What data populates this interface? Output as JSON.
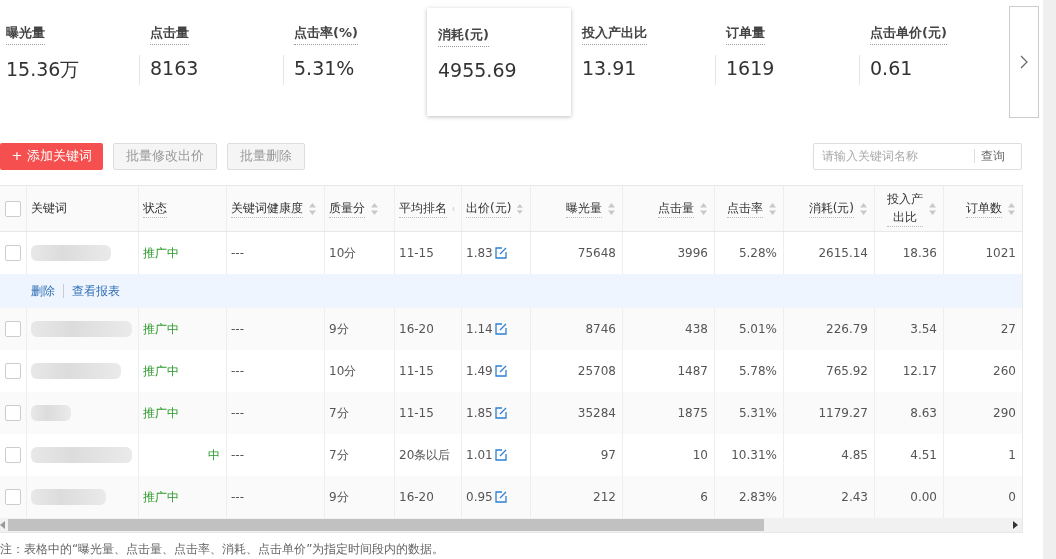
{
  "stats": [
    {
      "label": "曝光量",
      "value": "15.36万",
      "selected": false
    },
    {
      "label": "点击量",
      "value": "8163",
      "selected": false
    },
    {
      "label": "点击率(%)",
      "value": "5.31%",
      "selected": false
    },
    {
      "label": "消耗(元)",
      "value": "4955.69",
      "selected": true
    },
    {
      "label": "投入产出比",
      "value": "13.91",
      "selected": false
    },
    {
      "label": "订单量",
      "value": "1619",
      "selected": false
    },
    {
      "label": "点击单价(元)",
      "value": "0.61",
      "selected": false
    }
  ],
  "toolbar": {
    "add_button": "+ 添加关键词",
    "buttons": [
      "批量修改出价",
      "批量删除"
    ],
    "search": {
      "placeholder": "请输入关键词名称",
      "button": "查询"
    }
  },
  "table": {
    "all_checked": false,
    "columns": [
      {
        "label": "关键词",
        "sortable": false
      },
      {
        "label": "状态",
        "sortable": false
      },
      {
        "label": "关键词健康度",
        "sortable": true
      },
      {
        "label": "质量分",
        "sortable": true
      },
      {
        "label": "平均排名",
        "sortable": true
      },
      {
        "label": "出价(元)",
        "sortable": true
      },
      {
        "label": "曝光量",
        "sortable": true
      },
      {
        "label": "点击量",
        "sortable": true
      },
      {
        "label": "点击率",
        "sortable": true
      },
      {
        "label": "消耗(元)",
        "sortable": true
      },
      {
        "label": "投入产出比",
        "sortable": true
      },
      {
        "label": "订单数",
        "sortable": true
      }
    ],
    "rows": [
      {
        "checked": false,
        "status": "推广中",
        "health": "---",
        "quality": "10分",
        "rank": "11-15",
        "bid": "1.83",
        "cells": [
          "75648",
          "3996",
          "5.28%",
          "2615.14",
          "18.36",
          "1021"
        ],
        "actions": [
          "删除",
          "查看报表"
        ]
      },
      {
        "checked": false,
        "status": "推广中",
        "health": "---",
        "quality": "9分",
        "rank": "16-20",
        "bid": "1.14",
        "cells": [
          "8746",
          "438",
          "5.01%",
          "226.79",
          "3.54",
          "27"
        ]
      },
      {
        "checked": false,
        "status": "推广中",
        "health": "---",
        "quality": "10分",
        "rank": "11-15",
        "bid": "1.49",
        "cells": [
          "25708",
          "1487",
          "5.78%",
          "765.92",
          "12.17",
          "260"
        ]
      },
      {
        "checked": false,
        "status": "推广中",
        "health": "---",
        "quality": "7分",
        "rank": "11-15",
        "bid": "1.85",
        "cells": [
          "35284",
          "1875",
          "5.31%",
          "1179.27",
          "8.63",
          "290"
        ]
      },
      {
        "checked": false,
        "status": "中",
        "health": "---",
        "quality": "7分",
        "rank": "20条以后",
        "bid": "1.01",
        "cells": [
          "97",
          "10",
          "10.31%",
          "4.85",
          "4.51",
          "1"
        ]
      },
      {
        "checked": false,
        "status": "推广中",
        "health": "---",
        "quality": "9分",
        "rank": "16-20",
        "bid": "0.95",
        "cells": [
          "212",
          "6",
          "2.83%",
          "2.43",
          "0.00",
          "0"
        ]
      }
    ]
  },
  "footnote": "注：表格中的“曝光量、点击量、点击率、消耗、点击单价”为指定时间段内的数据。"
}
